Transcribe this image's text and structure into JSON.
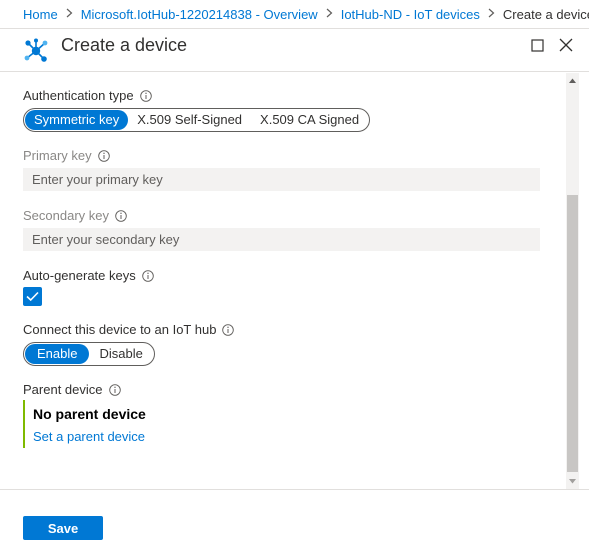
{
  "breadcrumb": {
    "items": [
      "Home",
      "Microsoft.IotHub-1220214838 - Overview",
      "IotHub-ND - IoT devices"
    ],
    "current": "Create a device"
  },
  "header": {
    "title": "Create a device",
    "icon": "iot-device-network-icon",
    "accent": "#0078d4"
  },
  "form": {
    "auth_type": {
      "label": "Authentication type",
      "options": [
        "Symmetric key",
        "X.509 Self-Signed",
        "X.509 CA Signed"
      ],
      "selected": "Symmetric key"
    },
    "primary_key": {
      "label": "Primary key",
      "value": "",
      "placeholder": "Enter your primary key"
    },
    "secondary_key": {
      "label": "Secondary key",
      "value": "",
      "placeholder": "Enter your secondary key"
    },
    "auto_generate": {
      "label": "Auto-generate keys",
      "checked": true
    },
    "connect": {
      "label": "Connect this device to an IoT hub",
      "options": [
        "Enable",
        "Disable"
      ],
      "selected": "Enable"
    },
    "parent": {
      "label": "Parent device",
      "value": "No parent device",
      "link": "Set a parent device",
      "accent": "#7fba00"
    }
  },
  "footer": {
    "save_label": "Save"
  }
}
